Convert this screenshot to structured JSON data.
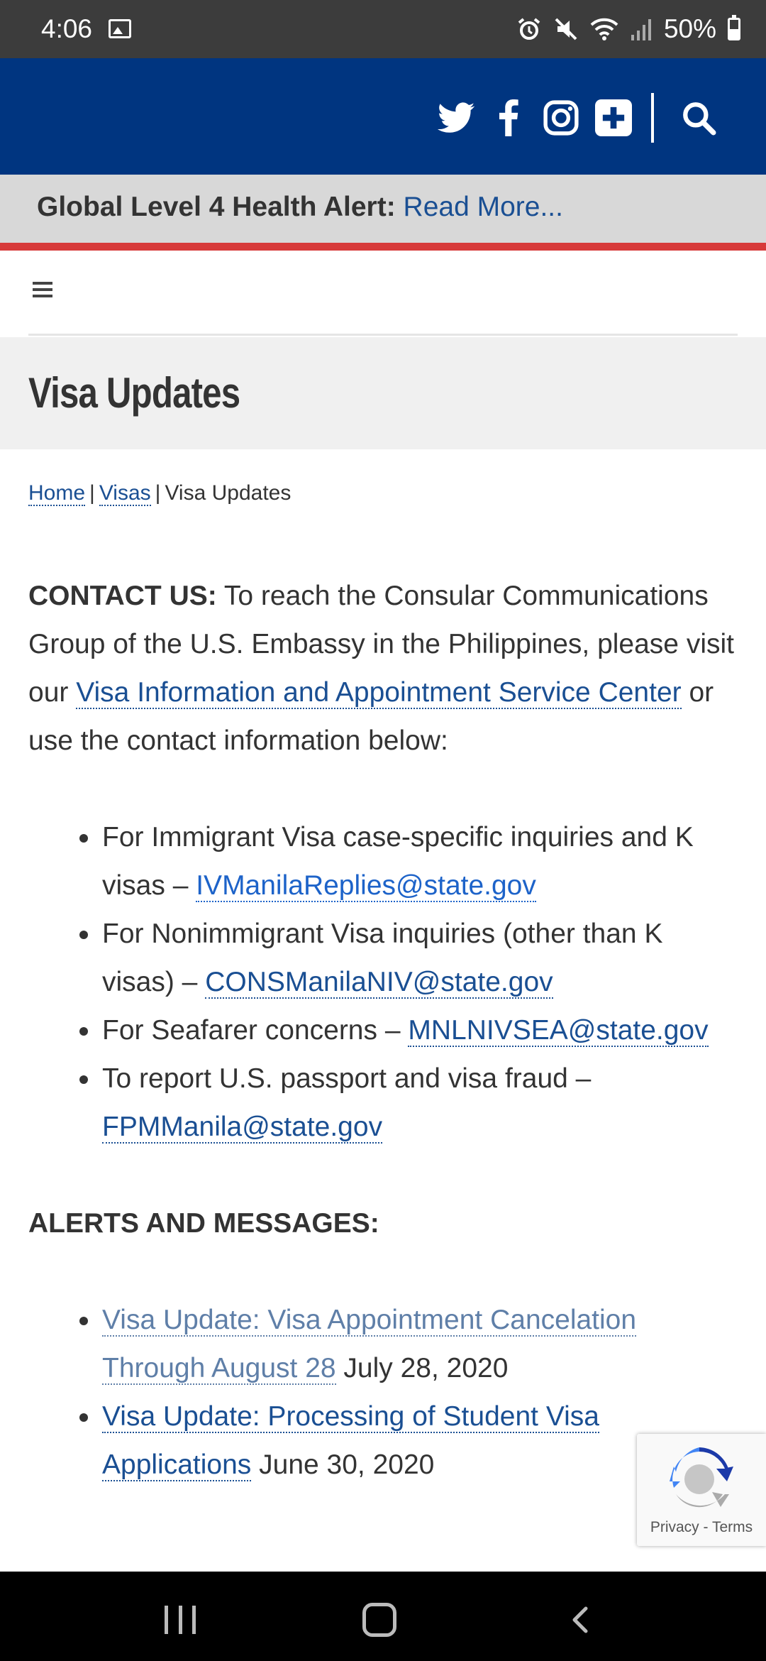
{
  "status_bar": {
    "time": "4:06",
    "battery_percent": "50%",
    "icons": [
      "image-icon",
      "alarm-icon",
      "mute-icon",
      "wifi-icon",
      "signal-icon",
      "battery-icon"
    ]
  },
  "header": {
    "background_color": "#003580",
    "social_icons": [
      "twitter-icon",
      "facebook-icon",
      "instagram-icon",
      "plus-icon",
      "search-icon"
    ]
  },
  "alert": {
    "label": "Global Level 4 Health Alert:",
    "link_text": "Read More...",
    "stripe_color": "#d73a3a"
  },
  "page": {
    "title": "Visa Updates"
  },
  "breadcrumb": {
    "home": "Home",
    "visas": "Visas",
    "current": "Visa Updates",
    "separator": "|"
  },
  "contact": {
    "heading": "CONTACT US:",
    "text_before": " To reach the Consular Communications Group of the U.S. Embassy in the Philippines, please visit our ",
    "link_text": "Visa Information and Appointment Service Center",
    "text_after": " or use the contact information below:",
    "items": [
      {
        "text": "For Immigrant Visa case-specific inquiries and K visas – ",
        "email": "IVManilaReplies@state.gov"
      },
      {
        "text": "For Nonimmigrant Visa inquiries (other than K visas) – ",
        "email": "CONSManilaNIV@state.gov"
      },
      {
        "text": "For Seafarer concerns – ",
        "email": "MNLNIVSEA@state.gov"
      },
      {
        "text": "To report U.S. passport and visa fraud – ",
        "email": "FPMManila@state.gov"
      }
    ]
  },
  "alerts": {
    "heading": "ALERTS AND MESSAGES:",
    "items": [
      {
        "title": "Visa Update: Visa Appointment Cancelation Through August 28",
        "date": "July 28, 2020"
      },
      {
        "title": "Visa Update: Processing of Student Visa Applications",
        "date": "June 30, 2020"
      }
    ]
  },
  "recaptcha": {
    "privacy": "Privacy",
    "separator": "-",
    "terms": "Terms"
  }
}
